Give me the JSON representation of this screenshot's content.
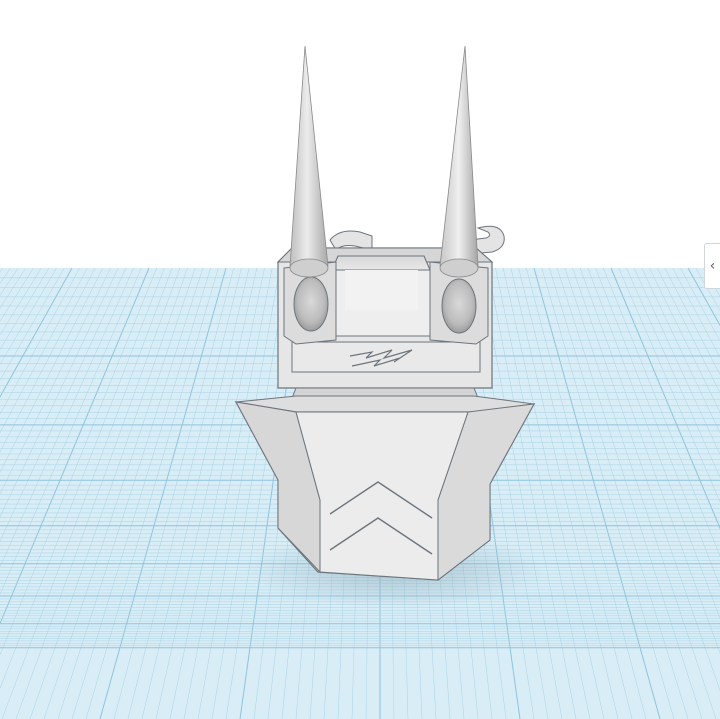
{
  "viewport": {
    "name": "3d-workplane-view",
    "background": "#ffffff",
    "grid_fill": "#d9edf6",
    "grid_line_color": "#a9d3e6",
    "grid_major_color": "#8ec4dc",
    "model_color": "#e2e2e2",
    "model_shadow": "#b9b9b9",
    "model_edge": "#5f6b74"
  },
  "side_panel_toggle": {
    "icon": "chevron-left-icon",
    "glyph": "‹"
  }
}
